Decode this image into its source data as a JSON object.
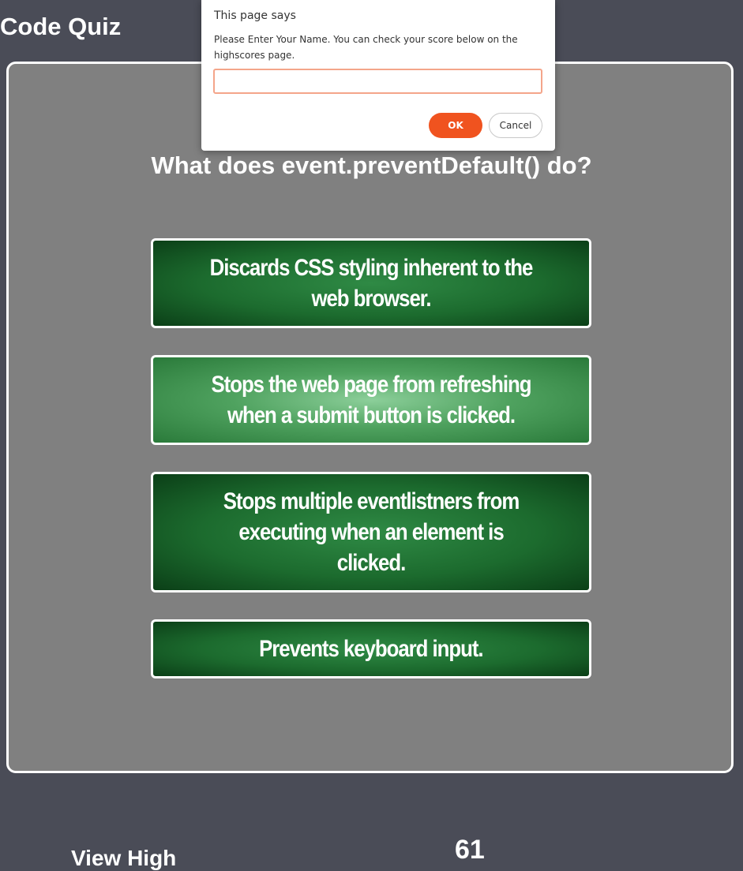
{
  "page": {
    "title": "Code Quiz"
  },
  "quiz": {
    "question": "What does event.preventDefault() do?",
    "answers": [
      {
        "label": "Discards CSS styling inherent to the web browser."
      },
      {
        "label": "Stops the web page from refreshing when a submit button is clicked."
      },
      {
        "label": "Stops multiple eventlistners from executing when an element is clicked."
      },
      {
        "label": "Prevents keyboard input."
      }
    ],
    "hovered_answer_index": 1
  },
  "footer": {
    "highscores_link": "View High",
    "timer": "61"
  },
  "dialog": {
    "title": "This page says",
    "message": "Please Enter Your Name. You can check your score below on the highscores page.",
    "input_value": "",
    "ok_label": "OK",
    "cancel_label": "Cancel"
  },
  "colors": {
    "page_background": "#4a4c57",
    "card_background": "#808080",
    "answer_green": "#1c6b2e",
    "ok_button": "#f0531f"
  }
}
